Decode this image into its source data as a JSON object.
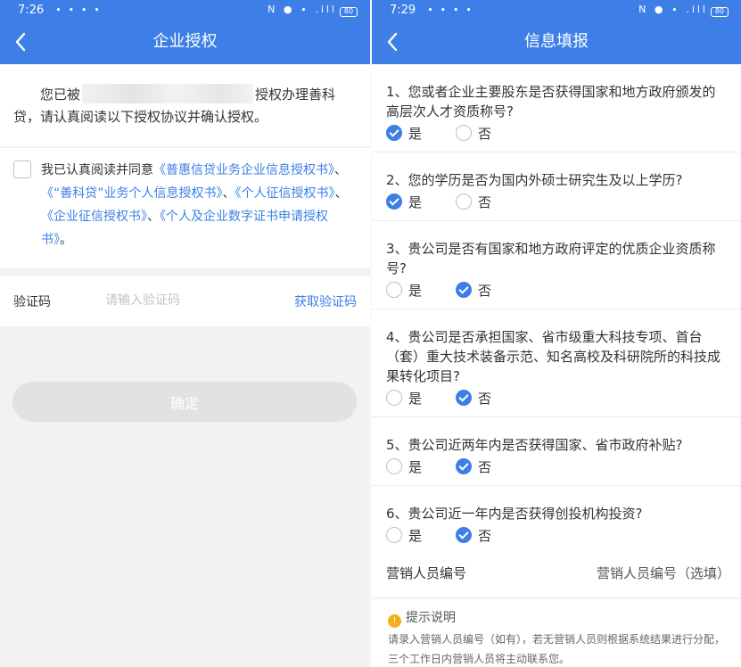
{
  "left_screen": {
    "status": {
      "time": "7:26",
      "indicators": "∙ ∙ ∙ ∙",
      "right_icons": "N ● ∙ .ill",
      "battery": "80"
    },
    "nav": {
      "title": "企业授权"
    },
    "intro": {
      "before": "您已被",
      "after": "授权办理善科贷，请认真阅读以下授权协议并确认授权。"
    },
    "agreement": {
      "prefix": "我已认真阅读并同意",
      "links": [
        "《普惠信贷业务企业信息授权书》",
        "《“善科贷”业务个人信息授权书》",
        "《个人征信授权书》",
        "《企业征信授权书》",
        "《个人及企业数字证书申请授权书》"
      ],
      "separator": "、",
      "suffix": "。"
    },
    "code": {
      "label": "验证码",
      "placeholder": "请输入验证码",
      "get_code": "获取验证码"
    },
    "confirm_label": "确定"
  },
  "right_screen": {
    "status": {
      "time": "7:29",
      "indicators": "∙ ∙ ∙ ∙",
      "right_icons": "N ● ∙ .ill",
      "battery": "80"
    },
    "nav": {
      "title": "信息填报"
    },
    "yes_label": "是",
    "no_label": "否",
    "questions": [
      {
        "text": "1、您或者企业主要股东是否获得国家和地方政府颁发的高层次人才资质称号?",
        "answer": "yes"
      },
      {
        "text": "2、您的学历是否为国内外硕士研究生及以上学历?",
        "answer": "yes"
      },
      {
        "text": "3、贵公司是否有国家和地方政府评定的优质企业资质称号?",
        "answer": "no"
      },
      {
        "text": "4、贵公司是否承担国家、省市级重大科技专项、首台（套）重大技术装备示范、知名高校及科研院所的科技成果转化项目?",
        "answer": "no"
      },
      {
        "text": "5、贵公司近两年内是否获得国家、省市政府补贴?",
        "answer": "no"
      },
      {
        "text": "6、贵公司近一年内是否获得创投机构投资?",
        "answer": "no"
      }
    ],
    "marketing": {
      "label": "营销人员编号",
      "placeholder": "营销人员编号（选填）"
    },
    "tip": {
      "title": "提示说明",
      "icon": "!",
      "body": "请录入营销人员编号（如有），若无营销人员则根据系统结果进行分配，三个工作日内营销人员将主动联系您。"
    }
  },
  "colors": {
    "primary": "#3d7fe6",
    "warning": "#f2b01e",
    "disabled": "#e2e2e2"
  }
}
